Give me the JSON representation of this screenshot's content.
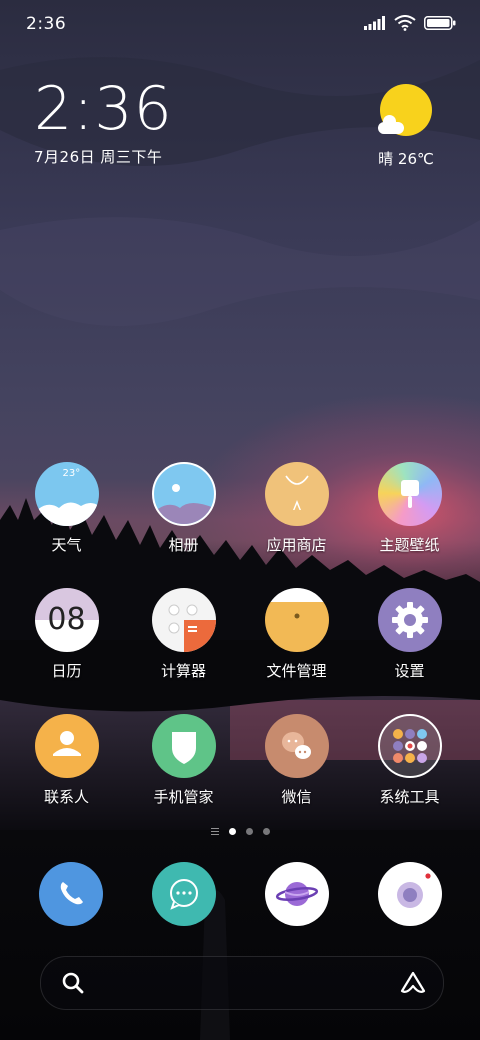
{
  "status_bar": {
    "time": "2:36"
  },
  "clock_widget": {
    "time": "2:36",
    "date": "7月26日 周三下午"
  },
  "weather_widget": {
    "text": "晴 26℃",
    "icon": "sunny-cloud-icon"
  },
  "apps": [
    {
      "label": "天气",
      "icon": "weather-icon",
      "badge": "23°"
    },
    {
      "label": "相册",
      "icon": "gallery-icon"
    },
    {
      "label": "应用商店",
      "icon": "app-store-icon"
    },
    {
      "label": "主题壁纸",
      "icon": "themes-icon"
    },
    {
      "label": "日历",
      "icon": "calendar-icon",
      "badge": "08"
    },
    {
      "label": "计算器",
      "icon": "calculator-icon"
    },
    {
      "label": "文件管理",
      "icon": "file-manager-icon"
    },
    {
      "label": "设置",
      "icon": "settings-icon"
    },
    {
      "label": "联系人",
      "icon": "contacts-icon"
    },
    {
      "label": "手机管家",
      "icon": "security-icon"
    },
    {
      "label": "微信",
      "icon": "wechat-icon"
    },
    {
      "label": "系统工具",
      "icon": "system-tools-folder-icon"
    }
  ],
  "page_indicator": {
    "pages": 3,
    "current": 1
  },
  "dock": [
    {
      "icon": "phone-icon"
    },
    {
      "icon": "messages-icon"
    },
    {
      "icon": "browser-icon"
    },
    {
      "icon": "camera-icon"
    }
  ],
  "search_bar": {
    "left_icon": "search-icon",
    "right_icon": "assistant-icon"
  },
  "colors": {
    "sun": "#f8d21c",
    "weather": "#7cc7ef",
    "gallery": "#7fc8f0",
    "app_store": "#f0c27a",
    "calendar_top": "#d9c7e0",
    "calculator_accent": "#ec6a3c",
    "file_manager": "#f2b955",
    "settings": "#8f7fc0",
    "contacts": "#f5b24a",
    "security": "#5fc488",
    "wechat": "#c78b6e",
    "phone": "#4f96e0",
    "messages": "#3fb9b0"
  }
}
